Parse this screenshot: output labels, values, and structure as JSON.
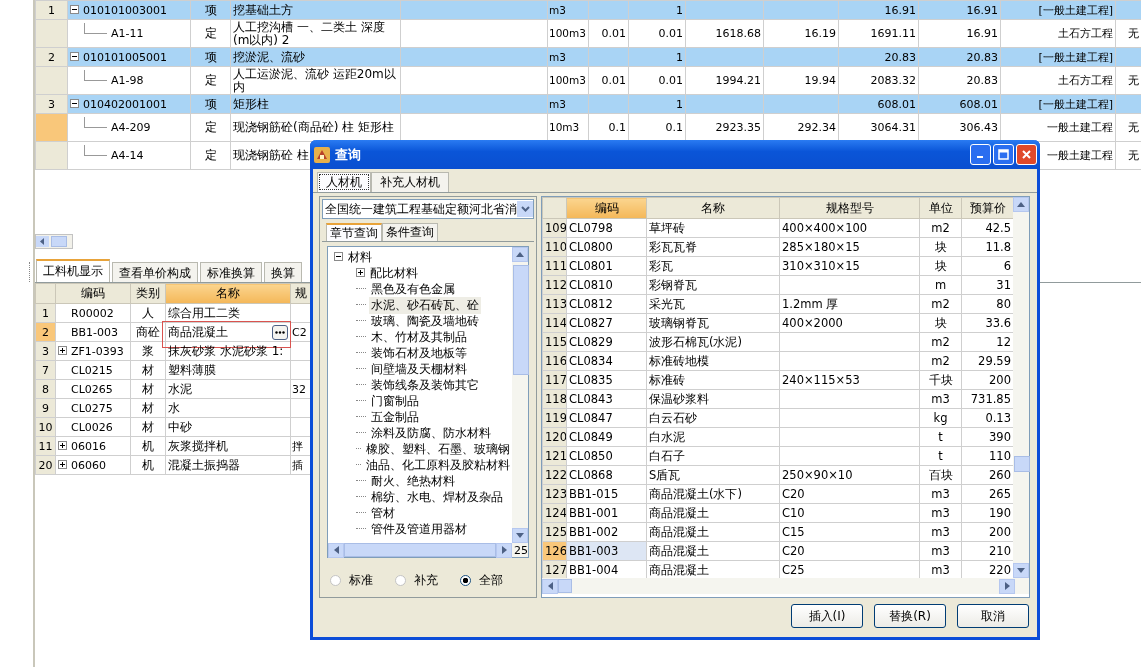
{
  "main_table": {
    "rows": [
      {
        "kind": "item",
        "selected": false,
        "expanded": true,
        "number": "1",
        "code": "010101003001",
        "type": "项",
        "name": "挖基础土方",
        "column_6": "m3",
        "column_8": "1",
        "column_11": "16.91",
        "column_12": "16.91",
        "column_13": "[一般土建工程]"
      },
      {
        "kind": "quota",
        "selected": false,
        "code": "A1-11",
        "type": "定",
        "name": "人工挖沟槽 一、二类土 深度(m以内) 2",
        "column_6": "100m3",
        "column_7": "0.01",
        "column_8": "0.01",
        "column_9": "1618.68",
        "column_10": "16.19",
        "column_11": "1691.11",
        "column_12": "16.91",
        "column_13": "土石方工程",
        "column_14": "无"
      },
      {
        "kind": "item",
        "selected": false,
        "expanded": true,
        "number": "2",
        "code": "010101005001",
        "type": "项",
        "name": "挖淤泥、流砂",
        "column_6": "m3",
        "column_8": "1",
        "column_11": "20.83",
        "column_12": "20.83",
        "column_13": "[一般土建工程]"
      },
      {
        "kind": "quota",
        "selected": false,
        "code": "A1-98",
        "type": "定",
        "name": "人工运淤泥、流砂 运距20m以内",
        "column_6": "100m3",
        "column_7": "0.01",
        "column_8": "0.01",
        "column_9": "1994.21",
        "column_10": "19.94",
        "column_11": "2083.32",
        "column_12": "20.83",
        "column_13": "土石方工程",
        "column_14": "无"
      },
      {
        "kind": "item",
        "selected": false,
        "expanded": true,
        "number": "3",
        "code": "010402001001",
        "type": "项",
        "name": "矩形柱",
        "column_6": "m3",
        "column_8": "1",
        "column_11": "608.01",
        "column_12": "608.01",
        "column_13": "[一般土建工程]"
      },
      {
        "kind": "quota",
        "selected": true,
        "code": "A4-209",
        "type": "定",
        "name": "现浇钢筋砼(商品砼) 柱 矩形柱",
        "column_6": "10m3",
        "column_7": "0.1",
        "column_8": "0.1",
        "column_9": "2923.35",
        "column_10": "292.34",
        "column_11": "3064.31",
        "column_12": "306.43",
        "column_13": "一般土建工程",
        "column_14": "无"
      },
      {
        "kind": "quota",
        "selected": false,
        "code": "A4-14",
        "type": "定",
        "name": "现浇钢筋砼 柱",
        "column_13": "一般土建工程",
        "column_14": "无"
      }
    ]
  },
  "detail_panel": {
    "tabs": [
      {
        "label": "工料机显示",
        "selected": true
      },
      {
        "label": "查看单价构成",
        "selected": false
      },
      {
        "label": "标准换算",
        "selected": false
      },
      {
        "label": "换算",
        "selected": false
      }
    ],
    "columns": [
      {
        "label": "编码",
        "selected": false
      },
      {
        "label": "类别",
        "selected": false
      },
      {
        "label": "名称",
        "selected": true
      },
      {
        "label": "规",
        "selected": false
      }
    ],
    "rows": [
      {
        "number": "1",
        "code": "R00002",
        "type": "人",
        "name": "综合用工二类",
        "selected": false,
        "editing": false,
        "highlighted": false
      },
      {
        "number": "2",
        "code": "BB1-003",
        "type": "商砼",
        "name": "商品混凝土",
        "column_5": "C2",
        "selected": true,
        "editing": true,
        "highlighted": true
      },
      {
        "number": "3",
        "expanded": false,
        "code": "ZF1-0393",
        "type": "浆",
        "name": "抹灰砂浆 水泥砂浆 1:",
        "selected": false,
        "editing": false,
        "highlighted": false
      },
      {
        "number": "7",
        "code": "CL0215",
        "type": "材",
        "name": "塑料薄膜",
        "selected": false,
        "editing": false,
        "highlighted": false
      },
      {
        "number": "8",
        "code": "CL0265",
        "type": "材",
        "name": "水泥",
        "column_5": "32",
        "selected": false,
        "editing": false,
        "highlighted": false
      },
      {
        "number": "9",
        "code": "CL0275",
        "type": "材",
        "name": "水",
        "selected": false,
        "editing": false,
        "highlighted": false
      },
      {
        "number": "10",
        "code": "CL0026",
        "type": "材",
        "name": "中砂",
        "selected": false,
        "editing": false,
        "highlighted": false
      },
      {
        "number": "11",
        "expanded": false,
        "code": "06016",
        "type": "机",
        "name": "灰浆搅拌机",
        "column_5": "拌",
        "selected": false,
        "editing": false,
        "highlighted": false
      },
      {
        "number": "20",
        "expanded": false,
        "code": "06060",
        "type": "机",
        "name": "混凝土振捣器",
        "column_5": "插",
        "selected": false,
        "editing": false,
        "highlighted": false
      }
    ]
  },
  "dialog": {
    "title": "查询",
    "tabs": [
      {
        "label": "人材机",
        "selected": true
      },
      {
        "label": "补充人材机",
        "selected": false
      }
    ],
    "library_select": {
      "value": "全国统一建筑工程基础定额河北省消"
    },
    "search_tabs": [
      {
        "label": "章节查询",
        "selected": true
      },
      {
        "label": "条件查询",
        "selected": false
      }
    ],
    "tree": [
      {
        "label": "材料",
        "expanded": true,
        "selected": false,
        "children": [
          {
            "label": "配比材料",
            "expanded": false,
            "selected": false
          },
          {
            "label": "黑色及有色金属",
            "selected": false
          },
          {
            "label": "水泥、砂石砖瓦、砼",
            "selected": true
          },
          {
            "label": "玻璃、陶瓷及墙地砖",
            "selected": false
          },
          {
            "label": "木、竹材及其制品",
            "selected": false
          },
          {
            "label": "装饰石材及地板等",
            "selected": false
          },
          {
            "label": "间壁墙及天棚材料",
            "selected": false
          },
          {
            "label": "装饰线条及装饰其它",
            "selected": false
          },
          {
            "label": "门窗制品",
            "selected": false
          },
          {
            "label": "五金制品",
            "selected": false
          },
          {
            "label": "涂料及防腐、防水材料",
            "selected": false
          },
          {
            "label": "橡胶、塑料、石墨、玻璃钢",
            "selected": false
          },
          {
            "label": "油品、化工原料及胶粘材料",
            "selected": false
          },
          {
            "label": "耐火、绝热材料",
            "selected": false
          },
          {
            "label": "棉纺、水电、焊材及杂品",
            "selected": false
          },
          {
            "label": "管材",
            "selected": false
          },
          {
            "label": "管件及管道用器材",
            "selected": false
          }
        ]
      }
    ],
    "tree_scroll_text": "25",
    "filter_options": [
      {
        "label": "标准",
        "selected": false
      },
      {
        "label": "补充",
        "selected": false
      },
      {
        "label": "全部",
        "selected": true
      }
    ],
    "grid": {
      "columns": [
        {
          "label": "编码",
          "selected": true
        },
        {
          "label": "名称",
          "selected": false
        },
        {
          "label": "规格型号",
          "selected": false
        },
        {
          "label": "单位",
          "selected": false
        },
        {
          "label": "预算价",
          "selected": false
        }
      ],
      "rows": [
        {
          "number": "109",
          "code": "CL0798",
          "name": "草坪砖",
          "spec": "400×400×100",
          "unit": "m2",
          "price": "42.5",
          "selected": false
        },
        {
          "number": "110",
          "code": "CL0800",
          "name": "彩瓦瓦脊",
          "spec": "285×180×15",
          "unit": "块",
          "price": "11.8",
          "selected": false
        },
        {
          "number": "111",
          "code": "CL0801",
          "name": "彩瓦",
          "spec": "310×310×15",
          "unit": "块",
          "price": "6",
          "selected": false
        },
        {
          "number": "112",
          "code": "CL0810",
          "name": "彩钢脊瓦",
          "unit": "m",
          "price": "31",
          "selected": false
        },
        {
          "number": "113",
          "code": "CL0812",
          "name": "采光瓦",
          "spec": "1.2mm 厚",
          "unit": "m2",
          "price": "80",
          "selected": false
        },
        {
          "number": "114",
          "code": "CL0827",
          "name": "玻璃钢脊瓦",
          "spec": "400×2000",
          "unit": "块",
          "price": "33.6",
          "selected": false
        },
        {
          "number": "115",
          "code": "CL0829",
          "name": "波形石棉瓦(水泥)",
          "unit": "m2",
          "price": "12",
          "selected": false
        },
        {
          "number": "116",
          "code": "CL0834",
          "name": "标准砖地模",
          "unit": "m2",
          "price": "29.59",
          "selected": false
        },
        {
          "number": "117",
          "code": "CL0835",
          "name": "标准砖",
          "spec": "240×115×53",
          "unit": "千块",
          "price": "200",
          "selected": false
        },
        {
          "number": "118",
          "code": "CL0843",
          "name": "保温砂浆料",
          "unit": "m3",
          "price": "731.85",
          "selected": false
        },
        {
          "number": "119",
          "code": "CL0847",
          "name": "白云石砂",
          "unit": "kg",
          "price": "0.13",
          "selected": false
        },
        {
          "number": "120",
          "code": "CL0849",
          "name": "白水泥",
          "unit": "t",
          "price": "390",
          "selected": false
        },
        {
          "number": "121",
          "code": "CL0850",
          "name": "白石子",
          "unit": "t",
          "price": "110",
          "selected": false
        },
        {
          "number": "122",
          "code": "CL0868",
          "name": "S盾瓦",
          "spec": "250×90×10",
          "unit": "百块",
          "price": "260",
          "selected": false
        },
        {
          "number": "123",
          "code": "BB1-015",
          "name": "商品混凝土(水下)",
          "spec": "C20",
          "unit": "m3",
          "price": "265",
          "selected": false
        },
        {
          "number": "124",
          "code": "BB1-001",
          "name": "商品混凝土",
          "spec": "C10",
          "unit": "m3",
          "price": "190",
          "selected": false
        },
        {
          "number": "125",
          "code": "BB1-002",
          "name": "商品混凝土",
          "spec": "C15",
          "unit": "m3",
          "price": "200",
          "selected": false
        },
        {
          "number": "126",
          "code": "BB1-003",
          "name": "商品混凝土",
          "spec": "C20",
          "unit": "m3",
          "price": "210",
          "selected": true
        },
        {
          "number": "127",
          "code": "BB1-004",
          "name": "商品混凝土",
          "spec": "C25",
          "unit": "m3",
          "price": "220",
          "selected": false
        }
      ]
    },
    "buttons": [
      {
        "label": "插入(I)"
      },
      {
        "label": "替换(R)"
      },
      {
        "label": "取消"
      }
    ]
  }
}
